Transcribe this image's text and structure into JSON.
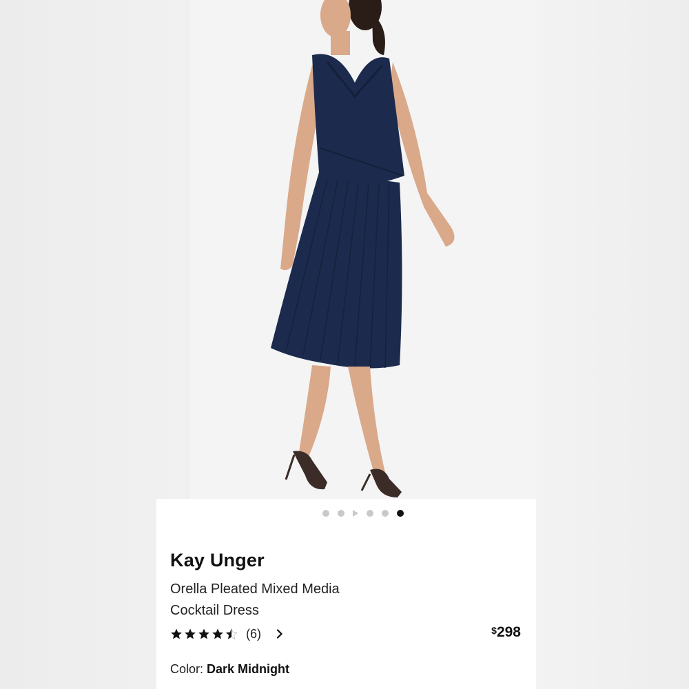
{
  "product": {
    "brand": "Kay Unger",
    "title_line1": "Orella Pleated Mixed Media",
    "title_line2": "Cocktail Dress",
    "rating_value": 4.5,
    "rating_count": "(6)",
    "price_currency": "$",
    "price_amount": "298",
    "color_label": "Color:",
    "color_value": "Dark Midnight"
  },
  "gallery": {
    "image_count": 6,
    "active_index": 6,
    "image_alt": "Model wearing navy pleated cocktail dress"
  },
  "colors": {
    "dress": "#1c2a4d",
    "dress_dark": "#141f3a",
    "skin": "#d9a98a",
    "star": "#111111"
  }
}
